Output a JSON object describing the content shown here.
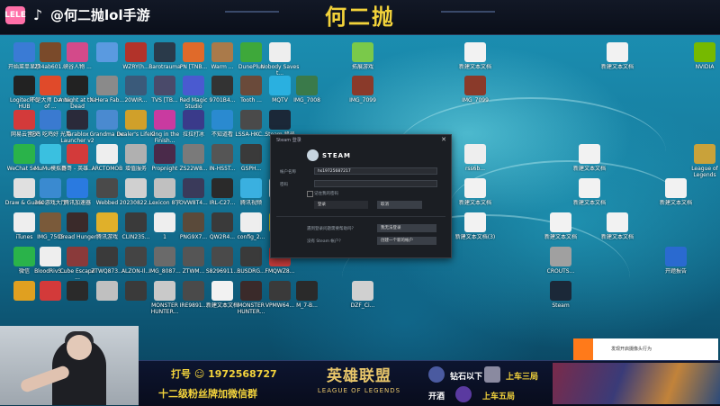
{
  "header": {
    "platform_logo": "lele",
    "platform_logo_text": "LELE",
    "tiktok_icon": "tiktok-icon",
    "handle": "@何二抛lol手游",
    "title": "何二抛"
  },
  "desktop_icons": [
    {
      "label": "开始菜单显示",
      "color": "#3a7bd5"
    },
    {
      "label": "234ab601...",
      "color": "#7a4a2a"
    },
    {
      "label": "峡谷人物 ...",
      "color": "#d34a8a"
    },
    {
      "label": "",
      "color": "#5a9ae0"
    },
    {
      "label": "WZRY(h...",
      "color": "#b2332a"
    },
    {
      "label": "Barotrauma",
      "color": "#2a3a4a"
    },
    {
      "label": "PN [TNB...",
      "color": "#e06a2a"
    },
    {
      "label": "Warm ...",
      "color": "#aa7a4a"
    },
    {
      "label": "DunePlus",
      "color": "#3ea83a"
    },
    {
      "label": "Nobody Saves t...",
      "color": "#eee"
    },
    {
      "label": "拓展游戏",
      "color": "#7ac94a"
    },
    {
      "label": "新建文本文档",
      "color": "#f2f2f2"
    },
    {
      "label": "新建文本文档",
      "color": "#f2f2f2"
    },
    {
      "label": "NVIDIA",
      "color": "#76b900"
    },
    {
      "label": "Logitech G HUB",
      "color": "#222"
    },
    {
      "label": "不是大师 Dance of ...",
      "color": "#e04a2a"
    },
    {
      "label": "A Night at the Dead",
      "color": "#222"
    },
    {
      "label": "X-Hera Fab...",
      "color": "#8a8a8a"
    },
    {
      "label": "20WIR...",
      "color": "#3a5a7a"
    },
    {
      "label": "TVS [TB...",
      "color": "#4a4a6a"
    },
    {
      "label": "Red Magic Studio",
      "color": "#4a5ad0"
    },
    {
      "label": "9701B4...",
      "color": "#333"
    },
    {
      "label": "Tooth ...",
      "color": "#6a4a3a"
    },
    {
      "label": "MQTV",
      "color": "#2ab0e0"
    },
    {
      "label": "IMG_7008",
      "color": "#3a7a4a"
    },
    {
      "label": "IMG_7099",
      "color": "#8a3a2a"
    },
    {
      "label": "IMG_7099",
      "color": "#8a3a2a"
    },
    {
      "label": "网易云音乐",
      "color": "#d33a3a"
    },
    {
      "label": "吃鸡 吃鸡好 光用",
      "color": "#3a7ad0"
    },
    {
      "label": "Tarablox Launcher v2",
      "color": "#2a2a3a"
    },
    {
      "label": "Grandma Inc",
      "color": "#4a8ad0"
    },
    {
      "label": "Dealer's Life 2",
      "color": "#d0a02a"
    },
    {
      "label": "King in the Finish...",
      "color": "#c93aa0"
    },
    {
      "label": "拉拉打冰",
      "color": "#3a3a8a"
    },
    {
      "label": "不知道看",
      "color": "#2a8ad0"
    },
    {
      "label": "LSSA-HKC...",
      "color": "#4a4a4a"
    },
    {
      "label": "Steam 登录",
      "color": "#1b2838"
    },
    {
      "label": "WeChat Se...",
      "color": "#2ab34a"
    },
    {
      "label": "MuMu模拟器",
      "color": "#3ac0e0"
    },
    {
      "label": "哥哥 - 英雄...",
      "color": "#d33a3a"
    },
    {
      "label": "ARCTOMOB",
      "color": "#eee"
    },
    {
      "label": "增值服务",
      "color": "#b0b0b0"
    },
    {
      "label": "Propnight",
      "color": "#4a2a4a"
    },
    {
      "label": "ZS22W8...",
      "color": "#7a7a7a"
    },
    {
      "label": "IN-HS5T...",
      "color": "#555"
    },
    {
      "label": "GSPH...",
      "color": "#3a3a3a"
    },
    {
      "label": "rss6b...",
      "color": "#eee"
    },
    {
      "label": "新建文本文档",
      "color": "#f2f2f2"
    },
    {
      "label": "League of Legends",
      "color": "#c9a23a"
    },
    {
      "label": "Draw & Guess",
      "color": "#e0e0e0"
    },
    {
      "label": "360游戏大厅",
      "color": "#3a8ad0"
    },
    {
      "label": "腾讯加速器",
      "color": "#2a7ae0"
    },
    {
      "label": "Webbed",
      "color": "#4a4a4a"
    },
    {
      "label": "20230822...",
      "color": "#d0d0d0"
    },
    {
      "label": "Lexicon 8字",
      "color": "#c0c0c0"
    },
    {
      "label": "OVW8T4...",
      "color": "#3a3a5a"
    },
    {
      "label": "IRL-C27...",
      "color": "#2a2a2a"
    },
    {
      "label": "腾讯视频",
      "color": "#3ab0e0"
    },
    {
      "label": "sms...",
      "color": "#eee"
    },
    {
      "label": "新建文本文档",
      "color": "#f2f2f2"
    },
    {
      "label": "新建文本文档",
      "color": "#f2f2f2"
    },
    {
      "label": "新建文本文档",
      "color": "#f2f2f2"
    },
    {
      "label": "iTunes",
      "color": "#eee"
    },
    {
      "label": "IMG_7505",
      "color": "#7a5a3a"
    },
    {
      "label": "Dread Hunger",
      "color": "#3a2a2a"
    },
    {
      "label": "腾讯游戏",
      "color": "#e0b02a"
    },
    {
      "label": "CLIN235...",
      "color": "#3a3a3a"
    },
    {
      "label": "1",
      "color": "#eee"
    },
    {
      "label": "PNG9X7...",
      "color": "#5a4a3a"
    },
    {
      "label": "QW2R4...",
      "color": "#3a3a3a"
    },
    {
      "label": "config_2...",
      "color": "#eee"
    },
    {
      "label": "Vbro...",
      "color": "#d0c020"
    },
    {
      "label": "新建文本文档(3)",
      "color": "#f2f2f2"
    },
    {
      "label": "新建文本文档",
      "color": "#f2f2f2"
    },
    {
      "label": "新建文本文档",
      "color": "#f2f2f2"
    },
    {
      "label": "微信",
      "color": "#2ab34a"
    },
    {
      "label": "BloodRivS...",
      "color": "#eee"
    },
    {
      "label": "Cube Escape ...",
      "color": "#8a3a3a"
    },
    {
      "label": "ZTWQ873...",
      "color": "#3a3a3a"
    },
    {
      "label": "ALZON-Il...",
      "color": "#444"
    },
    {
      "label": "IMG_8087...",
      "color": "#6a6a6a"
    },
    {
      "label": "ZTWM...",
      "color": "#555"
    },
    {
      "label": "S8296911...",
      "color": "#4a4a4a"
    },
    {
      "label": "BUSDRG...",
      "color": "#3a3a3a"
    },
    {
      "label": "FMQWZ8...",
      "color": "#c03a3a"
    },
    {
      "label": "CROUTS...",
      "color": "#a0a0a0"
    },
    {
      "label": "开题报告",
      "color": "#2a6ad0"
    },
    {
      "label": "",
      "color": "#e0a020"
    },
    {
      "label": "",
      "color": "#d33a3a"
    },
    {
      "label": "",
      "color": "#2a2a2a"
    },
    {
      "label": "",
      "color": "#c0c0c0"
    },
    {
      "label": "",
      "color": "#3a3a3a"
    },
    {
      "label": "MONSTER HUNTER...",
      "color": "#c9c9c9"
    },
    {
      "label": "IRE9891...",
      "color": "#4a4a4a"
    },
    {
      "label": "新建文本文档",
      "color": "#f2f2f2"
    },
    {
      "label": "MONSTER HUNTER...",
      "color": "#3a2a2a"
    },
    {
      "label": "VPMW64...",
      "color": "#3a3a3a"
    },
    {
      "label": "M_7-B...",
      "color": "#2a2a2a"
    },
    {
      "label": "DZF_Ci...",
      "color": "#d0d0d0"
    },
    {
      "label": "Steam",
      "color": "#1b2838"
    }
  ],
  "steam_login": {
    "window_title": "Steam 登录",
    "brand": "STEAM",
    "account_label": "帐户名称",
    "account_value": "hs19725687217",
    "password_label": "密码",
    "password_value": "",
    "remember_label": "记住我的密码",
    "login_label": "登录",
    "cancel_label": "取消",
    "forgot_label": "遇到登录问题需要帮助吗？",
    "forgot_button": "我无法登录",
    "no_account_label": "没有 Steam 帐户？",
    "create_button": "创建一个新的帐户",
    "close_icon": "close-icon"
  },
  "notification": {
    "text": "发现开启摄像头行为",
    "accent": "#ff7a1a"
  },
  "bottom_bar": {
    "fans_line1": "打号 ☺ 1972568727",
    "fans_line2": "十二级粉丝牌加微信群",
    "lol_cn": "英雄联盟",
    "lol_en": "LEAGUE OF LEGENDS",
    "rank1_prefix": "钻石以下",
    "rank1_value": "上车三局",
    "rank2_prefix": "开酒",
    "rank2_value": "上车五局"
  },
  "colors": {
    "title_yellow": "#f2d23a",
    "topbar_bg": "#0a0f1a",
    "steam_bg": "#1b1e23"
  }
}
